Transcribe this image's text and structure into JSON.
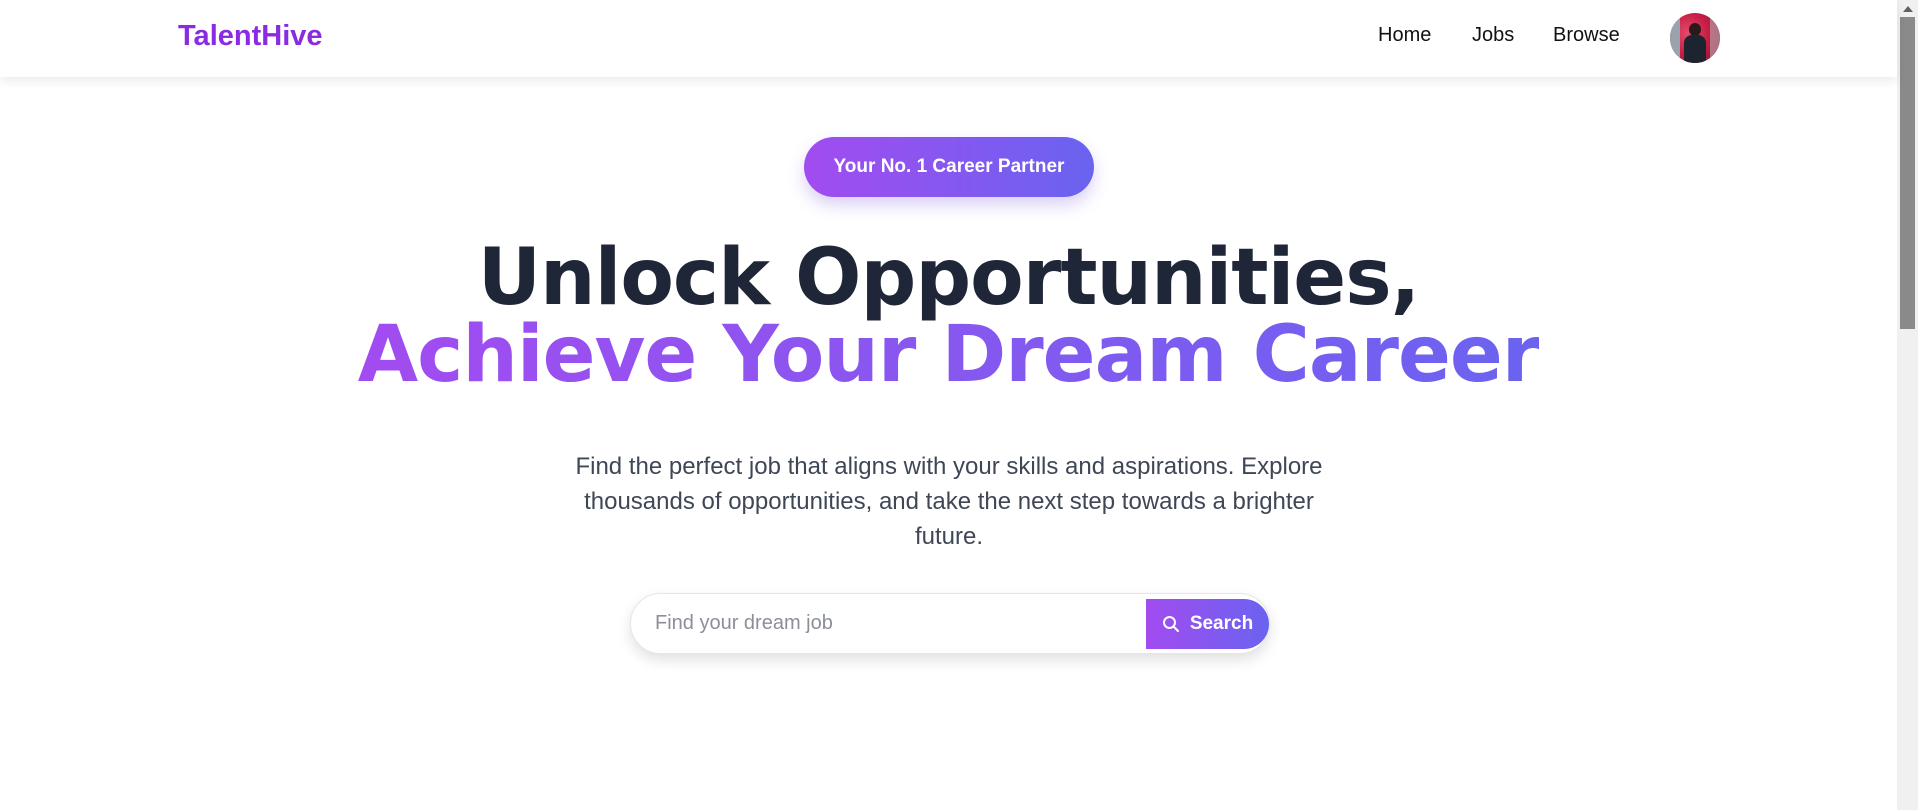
{
  "navbar": {
    "brand": "TalentHive",
    "links": [
      "Home",
      "Jobs",
      "Browse"
    ],
    "avatar_icon": "user-avatar"
  },
  "hero": {
    "badge": "Your No. 1 Career Partner",
    "headline_line1": "Unlock Opportunities,",
    "headline_line2": "Achieve Your Dream Career",
    "subtitle": "Find the perfect job that aligns with your skills and aspirations. Explore thousands of opportunities, and take the next step towards a brighter future."
  },
  "search": {
    "placeholder": "Find your dream job",
    "value": "",
    "button_label": "Search",
    "button_icon": "search-icon"
  },
  "colors": {
    "brand": "#8a2be2",
    "gradient_start": "#a24cf0",
    "gradient_end": "#6a63f0",
    "headline_dark": "#1f2637",
    "body_text": "#3f4756"
  }
}
